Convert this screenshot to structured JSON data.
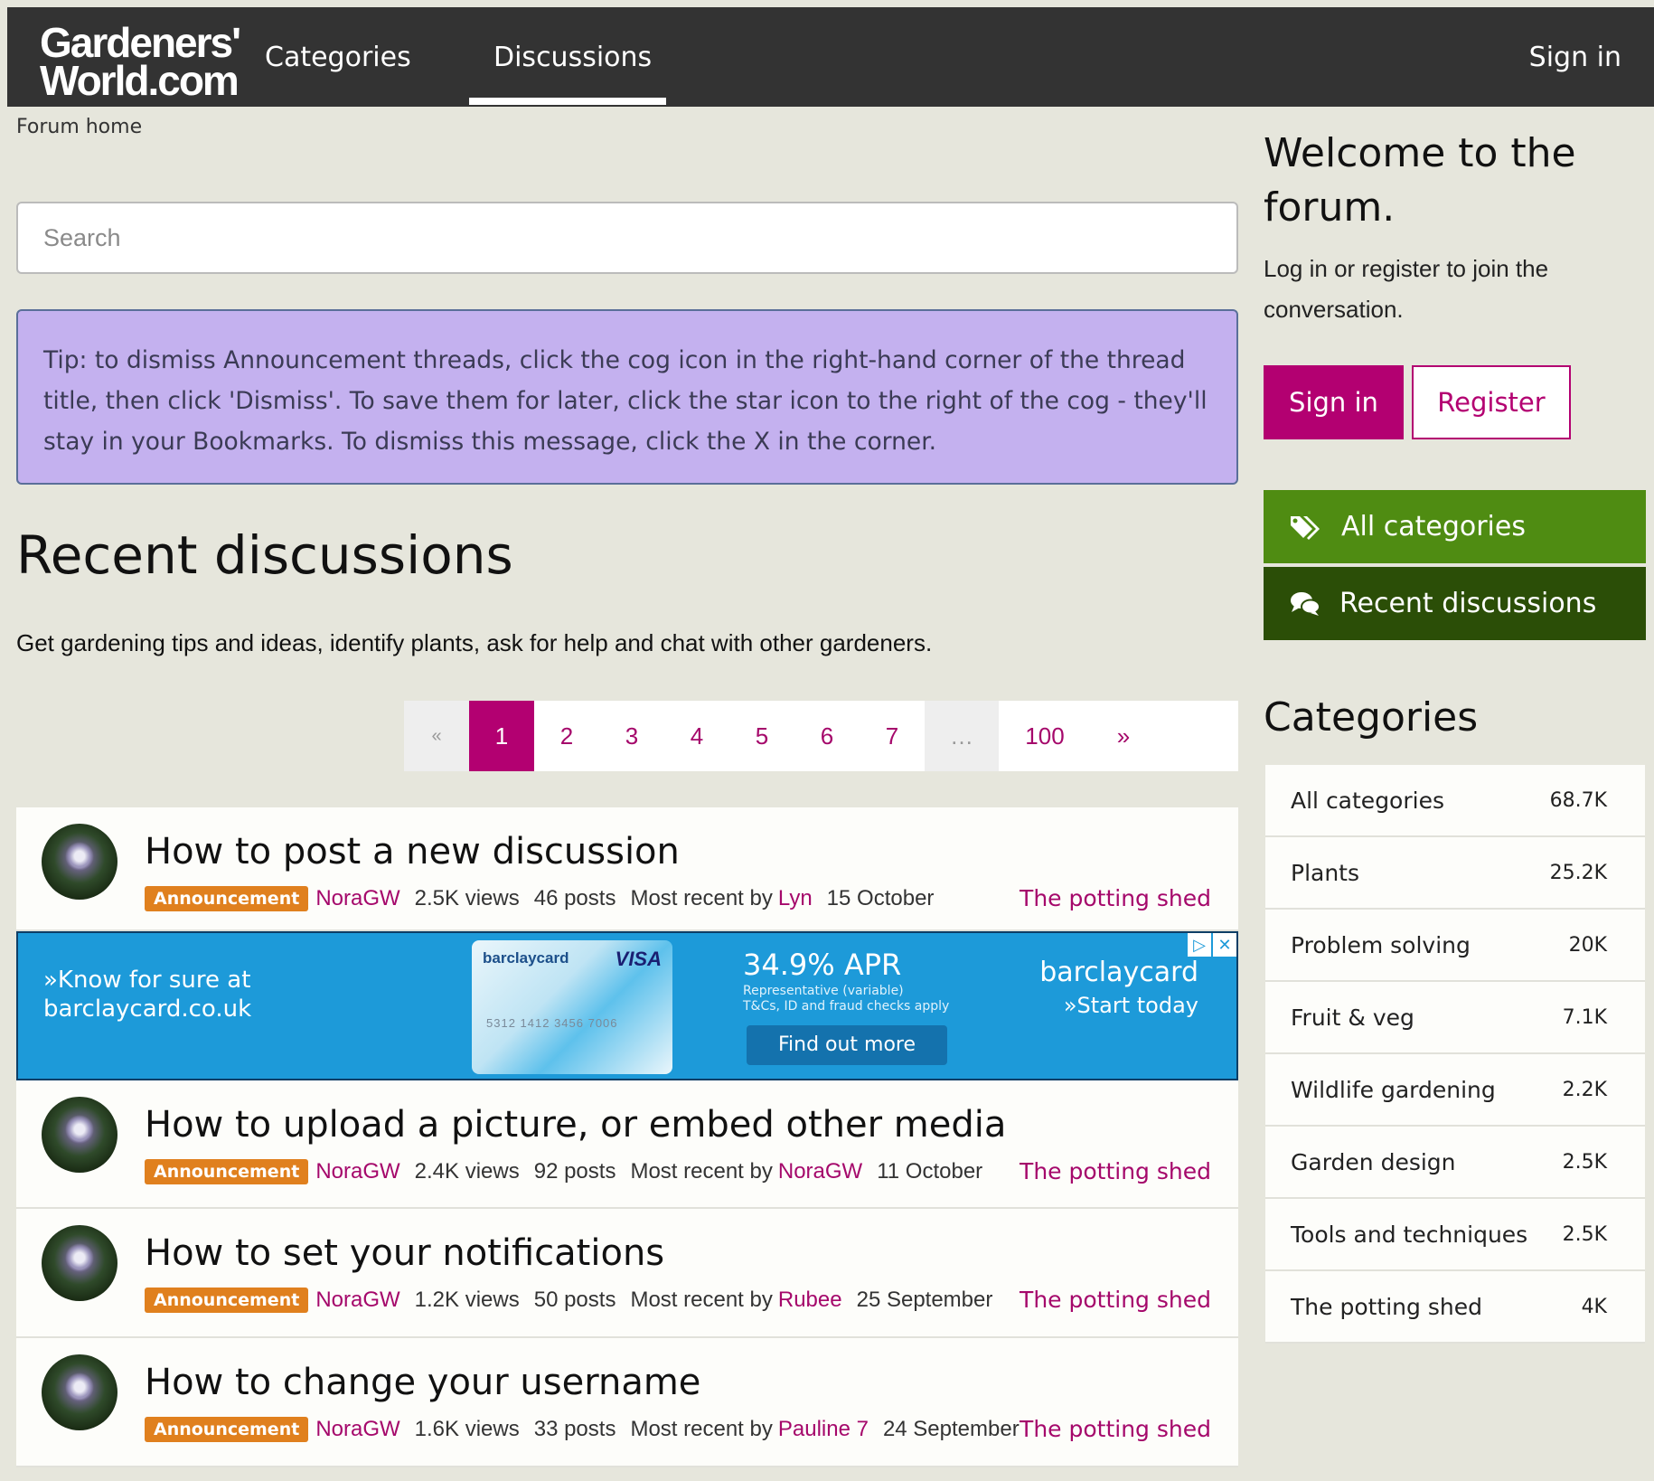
{
  "header": {
    "logo_line1": "Gardeners'",
    "logo_line2": "World.com",
    "nav": [
      {
        "label": "Categories"
      },
      {
        "label": "Discussions"
      }
    ],
    "sign_in": "Sign in"
  },
  "breadcrumb": "Forum home",
  "search": {
    "placeholder": "Search"
  },
  "tip": "Tip: to dismiss Announcement threads, click the cog icon in the right-hand corner of the thread title, then click 'Dismiss'. To save them for later, click the star icon to the right of the cog - they'll stay in your Bookmarks. To dismiss this message, click the X in the corner.",
  "main": {
    "title": "Recent discussions",
    "subtitle": "Get gardening tips and ideas, identify plants, ask for help and chat with other gardeners."
  },
  "pager": {
    "prev": "«",
    "pages": [
      "1",
      "2",
      "3",
      "4",
      "5",
      "6",
      "7"
    ],
    "ellipsis": "…",
    "last": "100",
    "next": "»",
    "active": "1"
  },
  "discussions": [
    {
      "title": "How to post a new discussion",
      "badge": "Announcement",
      "author": "NoraGW",
      "views": "2.5K views",
      "posts": "46 posts",
      "recent_label": "Most recent by",
      "recent_by": "Lyn",
      "date": "15 October",
      "category": "The potting shed"
    },
    {
      "title": "How to upload a picture, or embed other media",
      "badge": "Announcement",
      "author": "NoraGW",
      "views": "2.4K views",
      "posts": "92 posts",
      "recent_label": "Most recent by",
      "recent_by": "NoraGW",
      "date": "11 October",
      "category": "The potting shed"
    },
    {
      "title": "How to set your notifications",
      "badge": "Announcement",
      "author": "NoraGW",
      "views": "1.2K views",
      "posts": "50 posts",
      "recent_label": "Most recent by",
      "recent_by": "Rubee",
      "date": "25 September",
      "category": "The potting shed"
    },
    {
      "title": "How to change your username",
      "badge": "Announcement",
      "author": "NoraGW",
      "views": "1.6K views",
      "posts": "33 posts",
      "recent_label": "Most recent by",
      "recent_by": "Pauline 7",
      "date": "24 September",
      "category": "The potting shed"
    }
  ],
  "ad": {
    "left_line1": "»Know for sure at",
    "left_line2": "barclaycard.co.uk",
    "card_brand": "barclaycard",
    "card_visa": "VISA",
    "card_number": "5312 1412 3456 7006",
    "apr": "34.9% APR",
    "small_line1": "Representative (variable)",
    "small_line2": "T&Cs, ID and fraud checks apply",
    "button": "Find out more",
    "logo": "barclaycard",
    "cta": "»Start today",
    "icon_adchoices": "▷",
    "icon_close": "✕"
  },
  "sidebar": {
    "welcome_line1": "Welcome to the",
    "welcome_line2": "forum.",
    "welcome_sub": "Log in or register to join the conversation.",
    "sign_in": "Sign in",
    "register": "Register",
    "nav_all": "All categories",
    "nav_recent": "Recent discussions",
    "categories_title": "Categories",
    "categories": [
      {
        "name": "All categories",
        "count": "68.7K"
      },
      {
        "name": "Plants",
        "count": "25.2K"
      },
      {
        "name": "Problem solving",
        "count": "20K"
      },
      {
        "name": "Fruit & veg",
        "count": "7.1K"
      },
      {
        "name": "Wildlife gardening",
        "count": "2.2K"
      },
      {
        "name": "Garden design",
        "count": "2.5K"
      },
      {
        "name": "Tools and techniques",
        "count": "2.5K"
      },
      {
        "name": "The potting shed",
        "count": "4K"
      }
    ]
  },
  "colors": {
    "brand_magenta": "#b30071",
    "header_bg": "#333333",
    "page_bg": "#e6e6dc",
    "tip_bg": "#c4b1ef",
    "green": "#4f8c12",
    "dark_green": "#2b4e07",
    "badge_orange": "#e0801e"
  }
}
